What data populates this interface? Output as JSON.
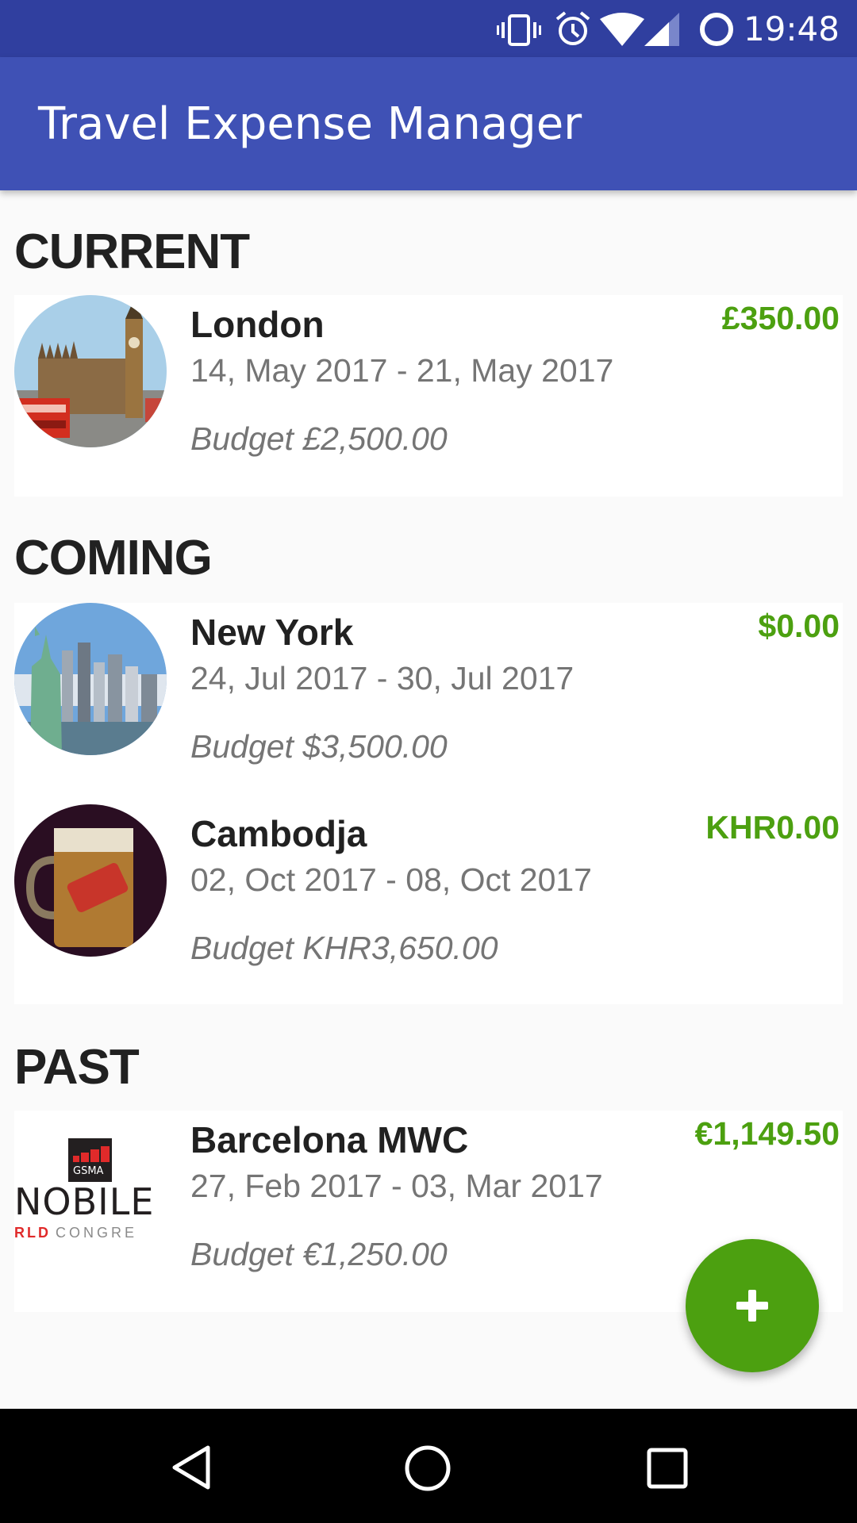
{
  "status_bar": {
    "time": "19:48",
    "icons": [
      "vibrate-icon",
      "alarm-icon",
      "wifi-icon",
      "cell-signal-icon",
      "data-saver-icon"
    ]
  },
  "app_bar": {
    "title": "Travel Expense Manager"
  },
  "sections": [
    {
      "title": "CURRENT",
      "trips": [
        {
          "name": "London",
          "dates": "14, May 2017 - 21, May 2017",
          "budget": "Budget £2,500.00",
          "spent": "£350.00",
          "image": "london-big-ben-photo"
        }
      ]
    },
    {
      "title": "COMING",
      "trips": [
        {
          "name": "New York",
          "dates": "24, Jul 2017 - 30, Jul 2017",
          "budget": "Budget $3,500.00",
          "spent": "$0.00",
          "image": "new-york-statue-of-liberty-photo"
        },
        {
          "name": "Cambodja",
          "dates": "02, Oct 2017 - 08, Oct 2017",
          "budget": "Budget KHR3,650.00",
          "spent": "KHR0.00",
          "image": "cambodia-beer-mug-photo"
        }
      ]
    },
    {
      "title": "PAST",
      "trips": [
        {
          "name": "Barcelona MWC",
          "dates": "27, Feb 2017 - 03, Mar 2017",
          "budget": "Budget €1,250.00",
          "spent": "€1,149.50",
          "image": "mobile-world-congress-logo"
        }
      ]
    }
  ],
  "mwc_logo": {
    "top": "GSMA",
    "main": "NOBILE",
    "sub_red": "RLD",
    "sub_grey": "CONGRE"
  },
  "fab": {
    "icon": "plus-icon",
    "action": "add-trip"
  },
  "colors": {
    "primary": "#3f51b5",
    "primary_dark": "#303f9f",
    "accent": "#4ca010",
    "text_primary": "#212121",
    "text_secondary": "#757575"
  },
  "nav_bar": {
    "buttons": [
      "back",
      "home",
      "recents"
    ]
  }
}
